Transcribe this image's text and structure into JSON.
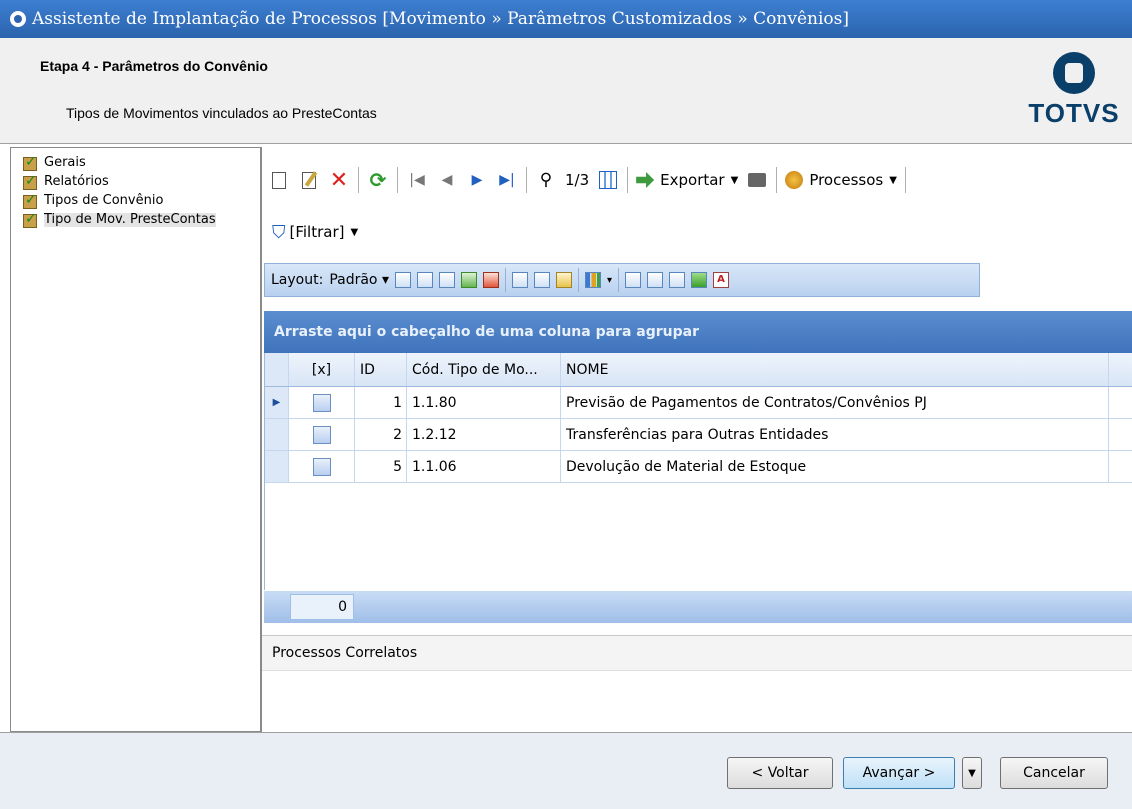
{
  "window": {
    "title": "Assistente de Implantação de Processos [Movimento » Parâmetros Customizados  » Convênios]"
  },
  "header": {
    "step_title": "Etapa 4 - Parâmetros do Convênio",
    "step_description": "Tipos de Movimentos vinculados ao PresteContas",
    "logo_text": "TOTVS"
  },
  "tree": {
    "items": [
      {
        "label": "Gerais"
      },
      {
        "label": "Relatórios"
      },
      {
        "label": "Tipos de Convênio"
      },
      {
        "label": "Tipo de Mov. PresteContas"
      }
    ]
  },
  "toolbar": {
    "record_position": "1/3",
    "export_label": "Exportar",
    "processes_label": "Processos",
    "filter_label": "[Filtrar]"
  },
  "layout_bar": {
    "label": "Layout:",
    "preset": "Padrão"
  },
  "grid": {
    "group_hint": "Arraste aqui o cabeçalho de uma coluna para agrupar",
    "columns": [
      "[x]",
      "ID",
      "Cód. Tipo de Mo...",
      "NOME"
    ],
    "rows": [
      {
        "id": "1",
        "code": "1.1.80",
        "name": "Previsão de Pagamentos de Contratos/Convênios PJ"
      },
      {
        "id": "2",
        "code": "1.2.12",
        "name": "Transferências para Outras Entidades"
      },
      {
        "id": "5",
        "code": "1.1.06",
        "name": "Devolução de Material de Estoque"
      }
    ],
    "footer_count": "0"
  },
  "related": {
    "label": "Processos Correlatos"
  },
  "buttons": {
    "back": "< Voltar",
    "next": "Avançar >",
    "cancel": "Cancelar"
  }
}
